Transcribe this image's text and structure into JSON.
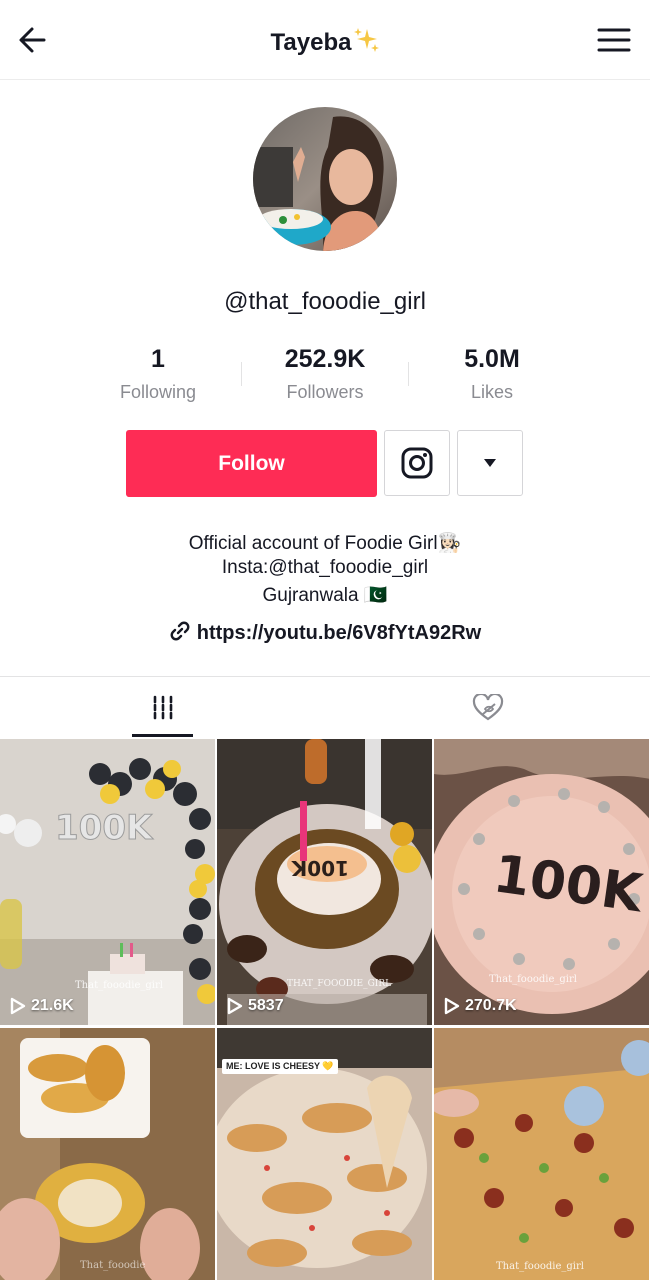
{
  "header": {
    "title": "Tayeba",
    "title_emoji_icon": "sparkles-icon",
    "back_icon": "arrow-left-icon",
    "menu_icon": "hamburger-menu-icon"
  },
  "profile": {
    "handle": "@that_fooodie_girl",
    "stats": [
      {
        "value": "1",
        "label": "Following"
      },
      {
        "value": "252.9K",
        "label": "Followers"
      },
      {
        "value": "5.0M",
        "label": "Likes"
      }
    ],
    "follow_label": "Follow",
    "instagram_icon": "instagram-icon",
    "more_icon": "caret-down-icon",
    "bio_lines": [
      "Official account of Foodie Girl👩🏻‍🍳",
      "Insta:@that_fooodie_girl",
      "Gujranwala 🇵🇰"
    ],
    "link": "https://youtu.be/6V8fYtA92Rw"
  },
  "tabs": {
    "videos_icon": "videos-grid-icon",
    "liked_icon": "liked-hidden-icon",
    "active": "videos"
  },
  "videos": [
    {
      "views": "21.6K",
      "watermark": "That_fooodie_girl"
    },
    {
      "views": "5837",
      "watermark": "THAT_FOOODIE_GIRL"
    },
    {
      "views": "270.7K",
      "watermark": "That_fooodie_girl"
    },
    {
      "views": "",
      "watermark": "That_fooodie"
    },
    {
      "views": "",
      "sticker": "ME: LOVE IS CHEESY 💛"
    },
    {
      "views": "",
      "watermark": "That_fooodie_girl"
    }
  ],
  "colors": {
    "accent": "#fe2c55",
    "text": "#161823",
    "muted": "#8a8b91"
  }
}
